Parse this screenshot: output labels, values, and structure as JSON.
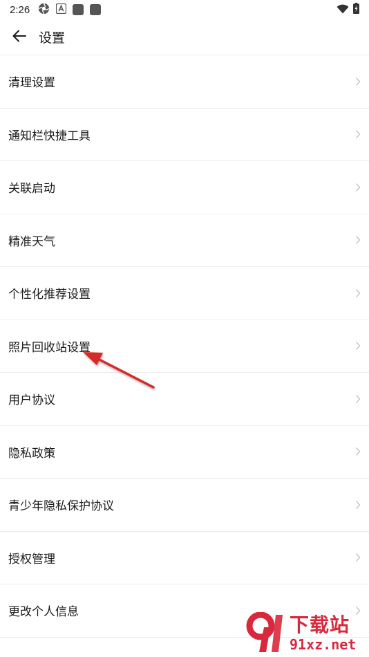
{
  "status_bar": {
    "time": "2:26",
    "icons_left": [
      "aperture-icon",
      "font-a-icon",
      "square-icon",
      "square-icon"
    ],
    "icons_right": [
      "wifi-icon",
      "battery-charging-icon"
    ]
  },
  "header": {
    "back_icon": "arrow-left-icon",
    "title": "设置"
  },
  "settings": {
    "items": [
      {
        "label": "清理设置"
      },
      {
        "label": "通知栏快捷工具"
      },
      {
        "label": "关联启动"
      },
      {
        "label": "精准天气"
      },
      {
        "label": "个性化推荐设置"
      },
      {
        "label": "照片回收站设置"
      },
      {
        "label": "用户协议"
      },
      {
        "label": "隐私政策"
      },
      {
        "label": "青少年隐私保护协议"
      },
      {
        "label": "授权管理"
      },
      {
        "label": "更改个人信息"
      }
    ]
  },
  "annotation": {
    "color": "#d42a2a",
    "points_to": "照片回收站设置"
  },
  "watermark": {
    "cn": "下载站",
    "en": "91xz.net",
    "color": "#d8283c"
  }
}
